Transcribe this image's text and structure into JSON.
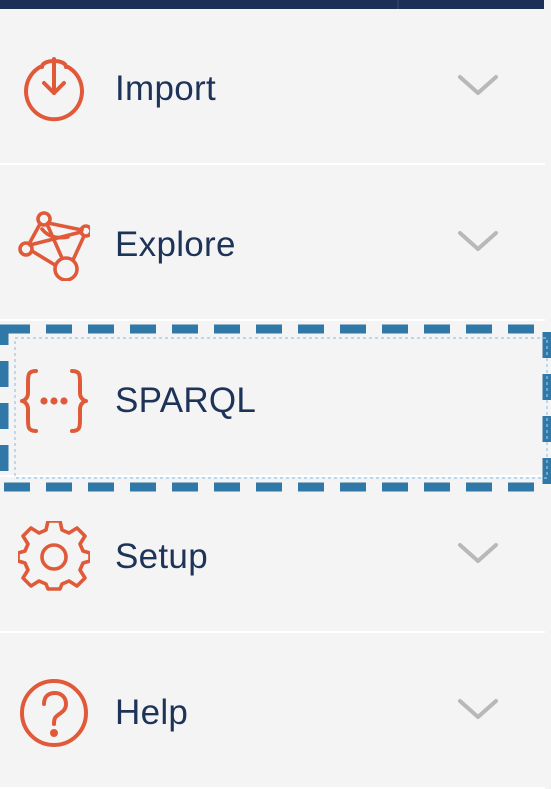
{
  "menu": {
    "items": [
      {
        "label": "Import",
        "icon": "import-icon",
        "expandable": true
      },
      {
        "label": "Explore",
        "icon": "graph-icon",
        "expandable": true
      },
      {
        "label": "SPARQL",
        "icon": "braces-icon",
        "expandable": false,
        "focused": true
      },
      {
        "label": "Setup",
        "icon": "gear-icon",
        "expandable": true
      },
      {
        "label": "Help",
        "icon": "help-icon",
        "expandable": true
      }
    ]
  },
  "colors": {
    "accent": "#e05a3a",
    "text": "#1e3358",
    "chevron": "#b8b8b8",
    "background": "#f4f4f4",
    "topbar": "#1c2f55",
    "focus": "#2f78a8"
  }
}
